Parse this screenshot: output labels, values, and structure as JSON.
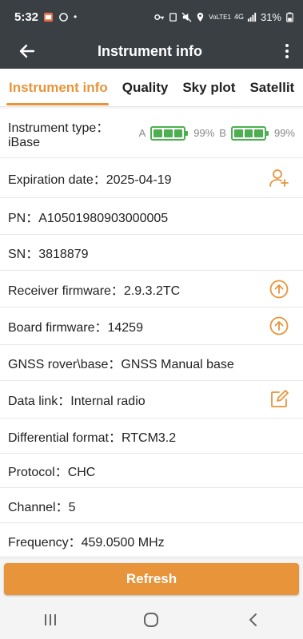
{
  "status": {
    "time": "5:32",
    "battery_percent": "31%",
    "network": "4G",
    "volte": "VoLTE1"
  },
  "appbar": {
    "title": "Instrument info"
  },
  "tabs": [
    {
      "label": "Instrument info",
      "active": true
    },
    {
      "label": "Quality"
    },
    {
      "label": "Sky plot"
    },
    {
      "label": "Satellit"
    }
  ],
  "rows": {
    "instrument_type": {
      "label": "Instrument type：",
      "value": "iBase"
    },
    "battery_a": {
      "label": "A",
      "percent": "99%",
      "level": 0.99
    },
    "battery_b": {
      "label": "B",
      "percent": "99%",
      "level": 0.99
    },
    "expiration": "Expiration date：2025-04-19",
    "pn": "PN：A10501980903000005",
    "sn": "SN：3818879",
    "receiver_fw": "Receiver firmware：2.9.3.2TC",
    "board_fw": "Board firmware：14259",
    "gnss_mode": "GNSS rover\\base：GNSS Manual base",
    "data_link": "Data link：Internal radio",
    "diff_format": "Differential format：RTCM3.2",
    "protocol": "Protocol：CHC",
    "channel": "Channel：5",
    "frequency": "Frequency：459.0500 MHz"
  },
  "refresh_button": "Refresh",
  "colors": {
    "accent": "#e8943a",
    "header": "#3a3f44",
    "battery": "#4caf50"
  },
  "icons": [
    "back-arrow-icon",
    "more-vert-icon",
    "add-user-icon",
    "upload-circle-icon",
    "edit-icon",
    "recents-icon",
    "home-icon",
    "back-nav-icon"
  ]
}
